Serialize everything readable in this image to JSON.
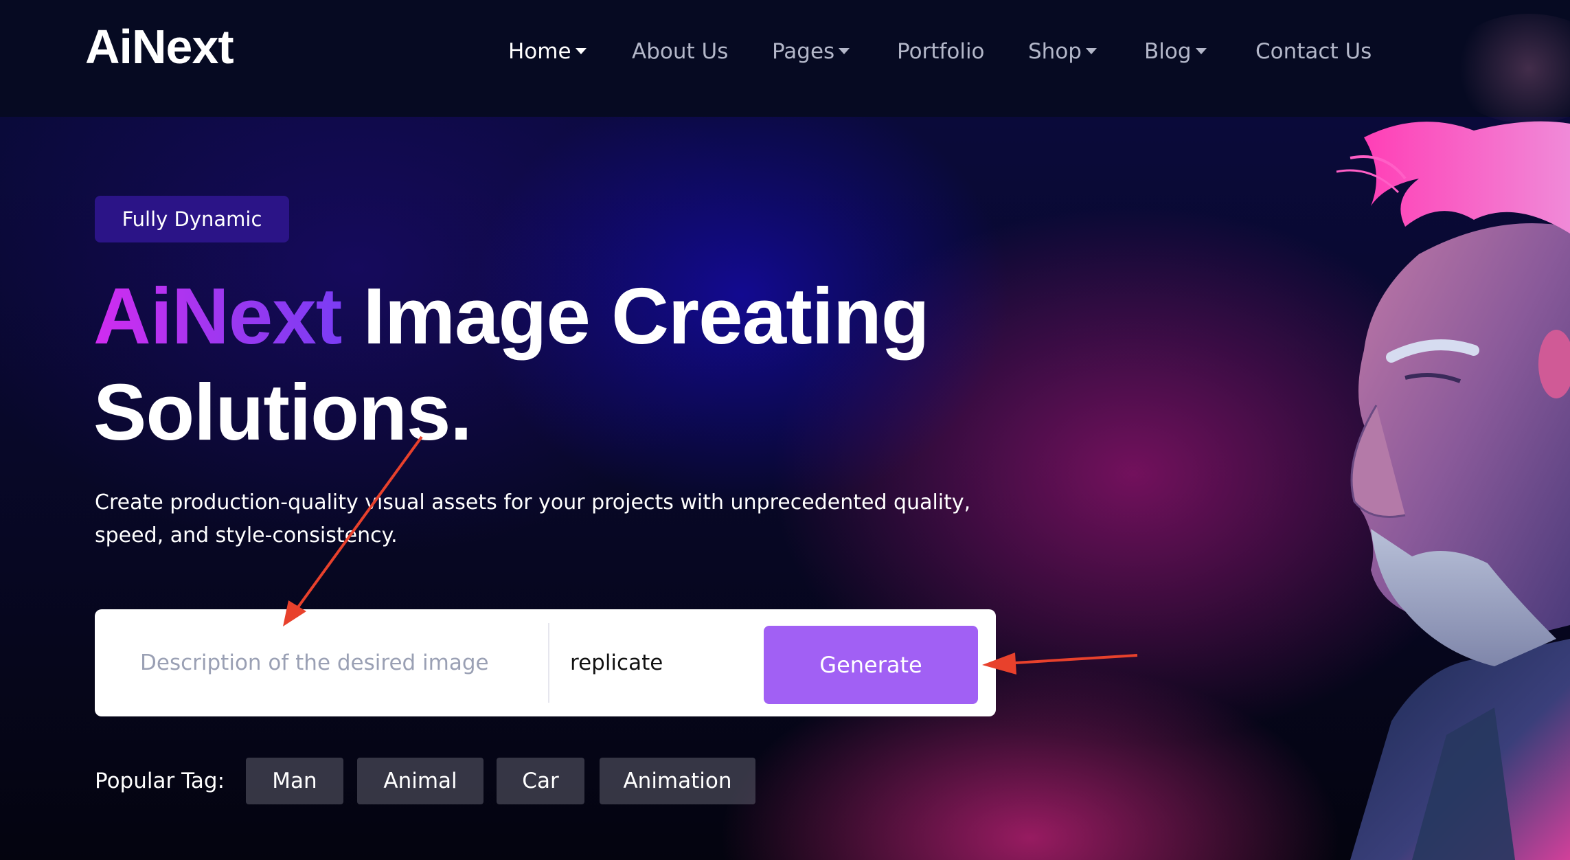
{
  "site": {
    "logo": "AiNext"
  },
  "nav": {
    "items": [
      {
        "label": "Home",
        "has_dropdown": true,
        "active": true
      },
      {
        "label": "About Us",
        "has_dropdown": false,
        "active": false
      },
      {
        "label": "Pages",
        "has_dropdown": true,
        "active": false
      },
      {
        "label": "Portfolio",
        "has_dropdown": false,
        "active": false
      },
      {
        "label": "Shop",
        "has_dropdown": true,
        "active": false
      },
      {
        "label": "Blog",
        "has_dropdown": true,
        "active": false
      },
      {
        "label": "Contact Us",
        "has_dropdown": false,
        "active": false
      }
    ]
  },
  "hero": {
    "badge": "Fully Dynamic",
    "headline_brand": "AiNext",
    "headline_line1_rest": " Image Creating",
    "headline_line2": "Solutions.",
    "subtext": "Create production-quality visual assets for your projects with unprecedented quality, speed, and style-consistency."
  },
  "search": {
    "placeholder": "Description of the desired image",
    "value": "",
    "model_value": "replicate",
    "generate_label": "Generate"
  },
  "tags": {
    "label": "Popular Tag:",
    "items": [
      "Man",
      "Animal",
      "Car",
      "Animation"
    ]
  },
  "colors": {
    "header_bg": "#060a22",
    "badge_bg": "#2b1487",
    "accent": "#a160f4",
    "gradient_start": "#d12cf0",
    "gradient_end": "#7b3cf4",
    "annotation_arrow": "#e8412c"
  },
  "icons": {
    "dropdown": "caret-down-icon",
    "annotation": "arrow-annotation"
  }
}
